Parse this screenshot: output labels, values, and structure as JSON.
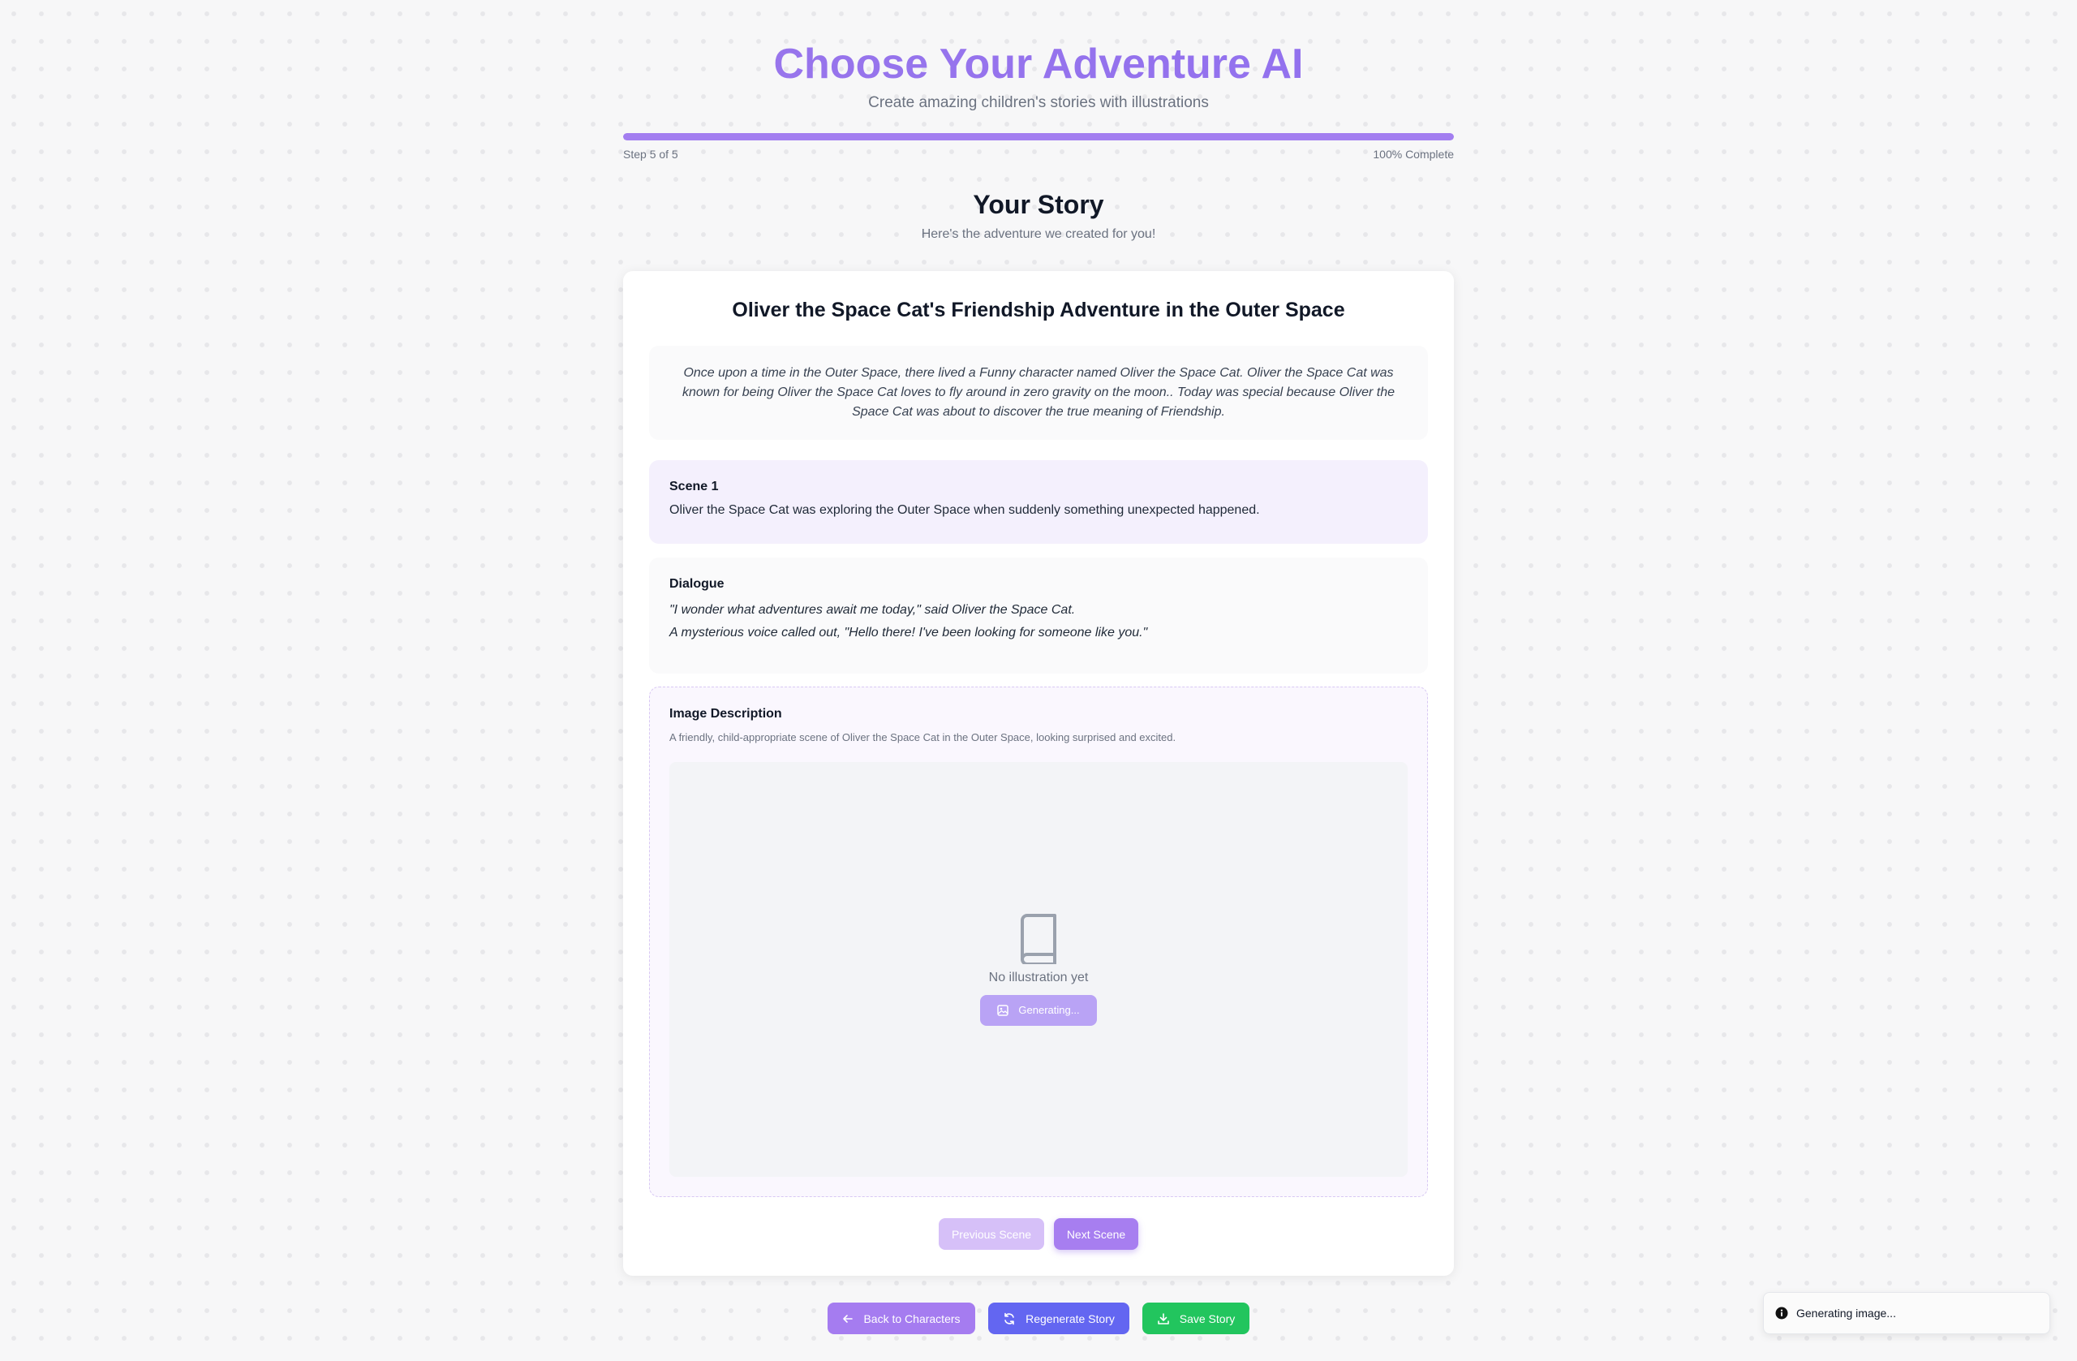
{
  "header": {
    "title": "Choose Your Adventure AI",
    "subtitle": "Create amazing children's stories with illustrations"
  },
  "progress": {
    "step_label": "Step 5 of 5",
    "complete_label": "100% Complete",
    "percent": 100
  },
  "section": {
    "title": "Your Story",
    "subtitle": "Here's the adventure we created for you!"
  },
  "story": {
    "title": "Oliver the Space Cat's Friendship Adventure in the Outer Space",
    "intro": "Once upon a time in the Outer Space, there lived a Funny character named Oliver the Space Cat. Oliver the Space Cat was known for being Oliver the Space Cat loves to fly around in zero gravity on the moon.. Today was special because Oliver the Space Cat was about to discover the true meaning of Friendship.",
    "scene": {
      "label": "Scene 1",
      "text": "Oliver the Space Cat was exploring the Outer Space when suddenly something unexpected happened."
    },
    "dialogue": {
      "label": "Dialogue",
      "lines": [
        "\"I wonder what adventures await me today,\" said Oliver the Space Cat.",
        "A mysterious voice called out, \"Hello there! I've been looking for someone like you.\""
      ]
    },
    "image": {
      "label": "Image Description",
      "description": "A friendly, child-appropriate scene of Oliver the Space Cat in the Outer Space, looking surprised and excited.",
      "placeholder_text": "No illustration yet",
      "generate_label": "Generating..."
    }
  },
  "scene_nav": {
    "previous_label": "Previous Scene",
    "next_label": "Next Scene"
  },
  "actions": {
    "back_label": "Back to Characters",
    "regenerate_label": "Regenerate Story",
    "save_label": "Save Story"
  },
  "toast": {
    "text": "Generating image..."
  },
  "colors": {
    "accent": "#a37ef0",
    "regenerate": "#6366f1",
    "save": "#22c55e"
  },
  "icons": {
    "placeholder": "book-icon",
    "generate": "image-icon",
    "back": "arrow-left-icon",
    "regenerate": "refresh-icon",
    "save": "download-icon",
    "toast": "info-icon"
  }
}
